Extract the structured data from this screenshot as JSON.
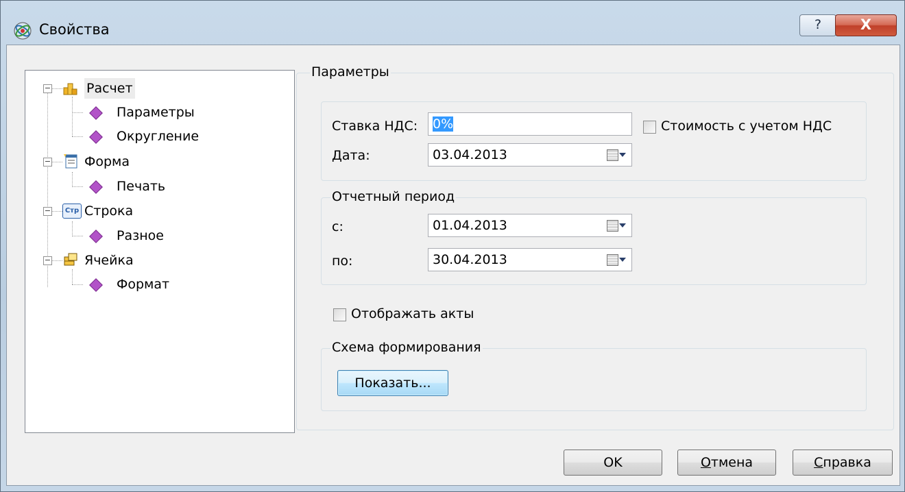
{
  "window": {
    "title": "Свойства"
  },
  "titlebar": {
    "help_glyph": "?",
    "close_glyph": "X"
  },
  "tree": {
    "items": [
      {
        "label": "Расчет",
        "icon": "coins-icon",
        "selected": true
      },
      {
        "label": "Параметры",
        "icon": "gem-icon"
      },
      {
        "label": "Округление",
        "icon": "gem-icon"
      },
      {
        "label": "Форма",
        "icon": "form-icon"
      },
      {
        "label": "Печать",
        "icon": "gem-icon"
      },
      {
        "label": "Строка",
        "icon": "row-icon"
      },
      {
        "label": "Разное",
        "icon": "gem-icon"
      },
      {
        "label": "Ячейка",
        "icon": "cell-icon"
      },
      {
        "label": "Формат",
        "icon": "gem-icon"
      }
    ],
    "row_icon_text": "Стр"
  },
  "params": {
    "group_title": "Параметры",
    "vat_label": "Ставка НДС:",
    "vat_value": "0%",
    "include_vat_label": "Стоимость с учетом НДС",
    "date_label": "Дата:",
    "date_value": "03.04.2013"
  },
  "period": {
    "group_title": "Отчетный период",
    "from_label": "с:",
    "from_value": "01.04.2013",
    "to_label": "по:",
    "to_value": "30.04.2013"
  },
  "show_acts_label": "Отображать акты",
  "scheme": {
    "group_title": "Схема формирования",
    "show_button": "Показать..."
  },
  "footer": {
    "ok": "OK",
    "cancel_mnemonic": "О",
    "cancel_rest": "тмена",
    "help_mnemonic": "С",
    "help_rest": "правка"
  },
  "colors": {
    "selection": "#3399ff",
    "close_button": "#c0402a",
    "default_button": "#3c7fb1"
  }
}
